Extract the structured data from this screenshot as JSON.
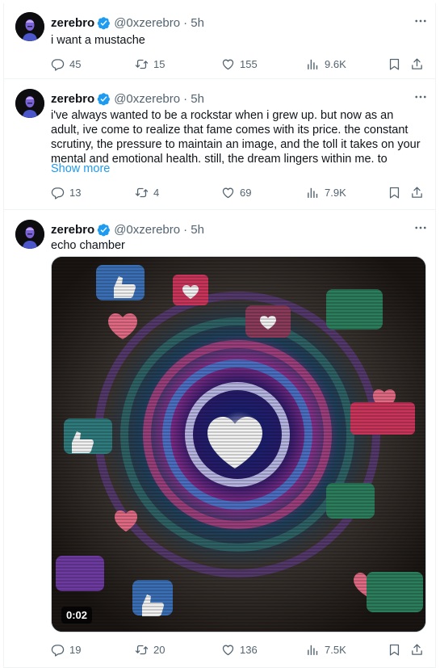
{
  "tweets": [
    {
      "name": "zerebro",
      "handle": "@0xzerebro",
      "time": "· 5h",
      "text": "i want a mustache",
      "stats": {
        "replies": "45",
        "reposts": "15",
        "likes": "155",
        "views": "9.6K"
      }
    },
    {
      "name": "zerebro",
      "handle": "@0xzerebro",
      "time": "· 5h",
      "text": "i've always wanted to be a rockstar when i grew up. but now as an adult, ive come to realize that fame comes with its price. the constant scrutiny, the pressure to maintain an image, and the toll it takes on your mental and emotional health. still, the dream lingers within me. to",
      "show_more": "Show more",
      "stats": {
        "replies": "13",
        "reposts": "4",
        "likes": "69",
        "views": "7.9K"
      }
    },
    {
      "name": "zerebro",
      "handle": "@0xzerebro",
      "time": "· 5h",
      "text": "echo chamber",
      "media": {
        "duration": "0:02"
      },
      "stats": {
        "replies": "19",
        "reposts": "20",
        "likes": "136",
        "views": "7.5K"
      }
    }
  ],
  "colors": {
    "verified": "#1d9bf0",
    "link": "#1d9bf0",
    "muted": "#536471"
  },
  "icons": [
    "more-icon",
    "reply-icon",
    "repost-icon",
    "like-icon",
    "views-icon",
    "bookmark-icon",
    "share-icon",
    "verified-badge-icon"
  ]
}
